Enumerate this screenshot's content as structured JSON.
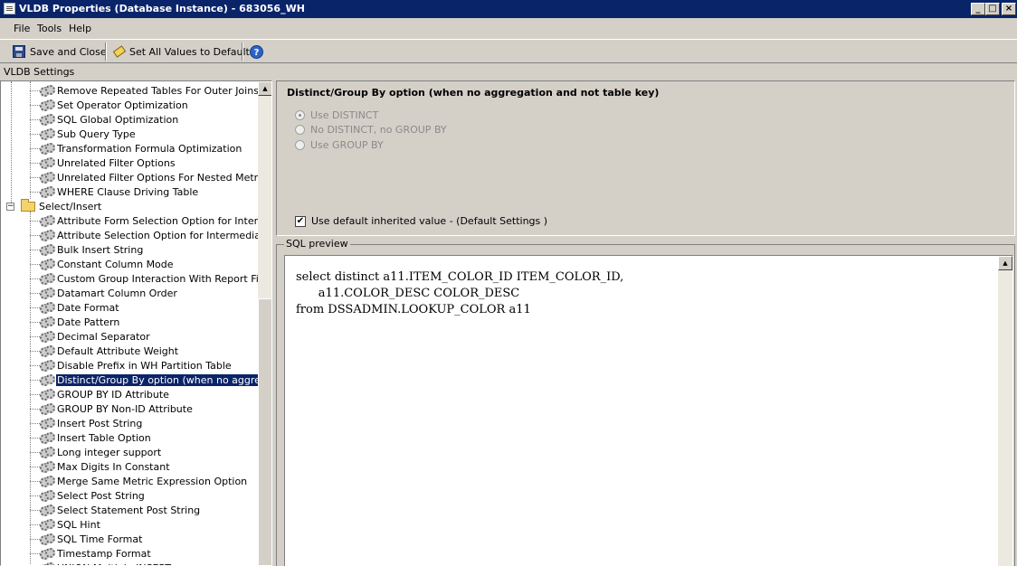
{
  "window": {
    "title": "VLDB Properties (Database Instance) - 683056_WH",
    "minimize": "_",
    "maximize": "□",
    "close": "×"
  },
  "menu": [
    "File",
    "Tools",
    "Help"
  ],
  "toolbar": {
    "save_close_label": "Save and Close",
    "set_default_label": "Set All Values to Default",
    "help_label": "?"
  },
  "section_label": "VLDB Settings",
  "tree": {
    "items_before": [
      "Remove Repeated Tables For Outer Joins",
      "Set Operator Optimization",
      "SQL Global Optimization",
      "Sub Query Type",
      "Transformation Formula Optimization",
      "Unrelated Filter Options",
      "Unrelated Filter Options For Nested Metrics",
      "WHERE Clause Driving Table"
    ],
    "folder_label": "Select/Insert",
    "expander": "−",
    "folder_items": [
      "Attribute Form Selection Option for Intermediate Pass",
      "Attribute Selection Option for Intermediate Pass",
      "Bulk Insert String",
      "Constant Column Mode",
      "Custom Group Interaction With Report Filter",
      "Datamart Column Order",
      "Date Format",
      "Date Pattern",
      "Decimal Separator",
      "Default Attribute Weight",
      "Disable Prefix in WH Partition Table",
      "Distinct/Group By option (when no aggregation and not table key)",
      "GROUP BY ID Attribute",
      "GROUP BY Non-ID Attribute",
      "Insert Post String",
      "Insert Table Option",
      "Long integer support",
      "Max Digits In Constant",
      "Merge Same Metric Expression Option",
      "Select Post String",
      "Select Statement Post String",
      "SQL Hint",
      "SQL Time Format",
      "Timestamp Format",
      "UNION Multiple INSERT"
    ],
    "selected_index": 11,
    "scroll_up": "▲"
  },
  "options": {
    "title": "Distinct/Group By option (when no aggregation and not table key)",
    "radios": [
      {
        "label": "Use DISTINCT",
        "checked": true
      },
      {
        "label": "No DISTINCT, no GROUP BY",
        "checked": false
      },
      {
        "label": "Use GROUP BY",
        "checked": false
      }
    ],
    "use_default_label": "Use default inherited value - (Default Settings )",
    "use_default_checked": true,
    "check_mark": "✔"
  },
  "sql_preview": {
    "label": "SQL preview",
    "text": "select distinct a11.ITEM_COLOR_ID ITEM_COLOR_ID,\n      a11.COLOR_DESC COLOR_DESC\nfrom DSSADMIN.LOOKUP_COLOR a11",
    "scroll_up": "▲"
  }
}
